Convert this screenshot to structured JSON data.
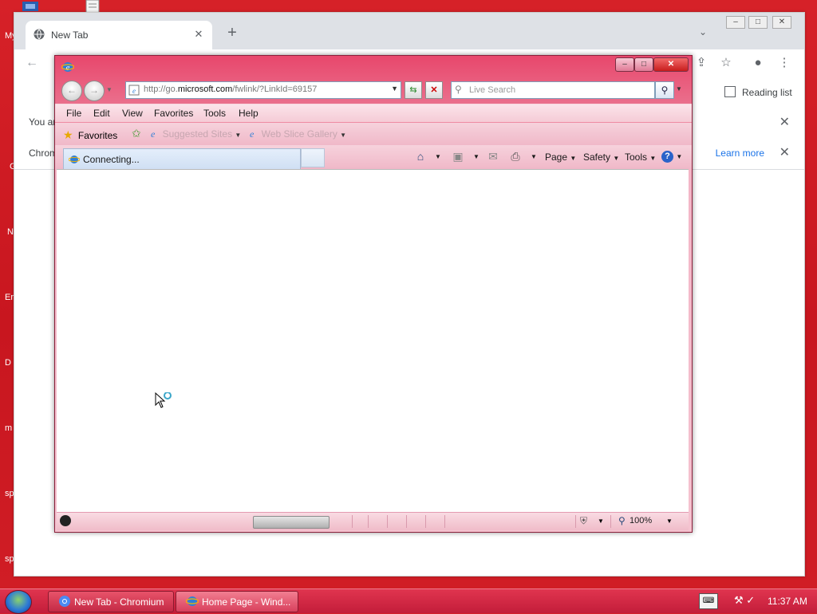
{
  "desktop": {
    "icon_labels": [
      "My",
      "G",
      "N",
      "Er",
      "D",
      "m",
      "sp",
      "sp"
    ]
  },
  "chromium": {
    "tab_title": "New Tab",
    "tab_close": "✕",
    "new_tab": "+",
    "reading_list": "Reading list",
    "infobar_text": "You ar",
    "infobar2_text": "Chrom",
    "learn_more": "Learn more",
    "close_glyph": "✕"
  },
  "ie": {
    "address_prefix": "http://go.",
    "address_domain": "microsoft.com",
    "address_suffix": "/fwlink/?LinkId=69157",
    "search_placeholder": "Live Search",
    "menu": [
      "File",
      "Edit",
      "View",
      "Favorites",
      "Tools",
      "Help"
    ],
    "favorites_label": "Favorites",
    "suggested_sites": "Suggested Sites",
    "web_slice_gallery": "Web Slice Gallery",
    "tab_label": "Connecting...",
    "page_label": "Page",
    "safety_label": "Safety",
    "tools_label": "Tools",
    "zoom": "100%",
    "progress": 0.0
  },
  "taskbar": {
    "chromium_task": "New Tab - Chromium",
    "ie_task": "Home Page - Wind...",
    "clock": "11:37 AM"
  },
  "colors": {
    "desktop": "#d3202a",
    "ie_frame": "#ea6f8c",
    "link": "#1a73e8"
  }
}
